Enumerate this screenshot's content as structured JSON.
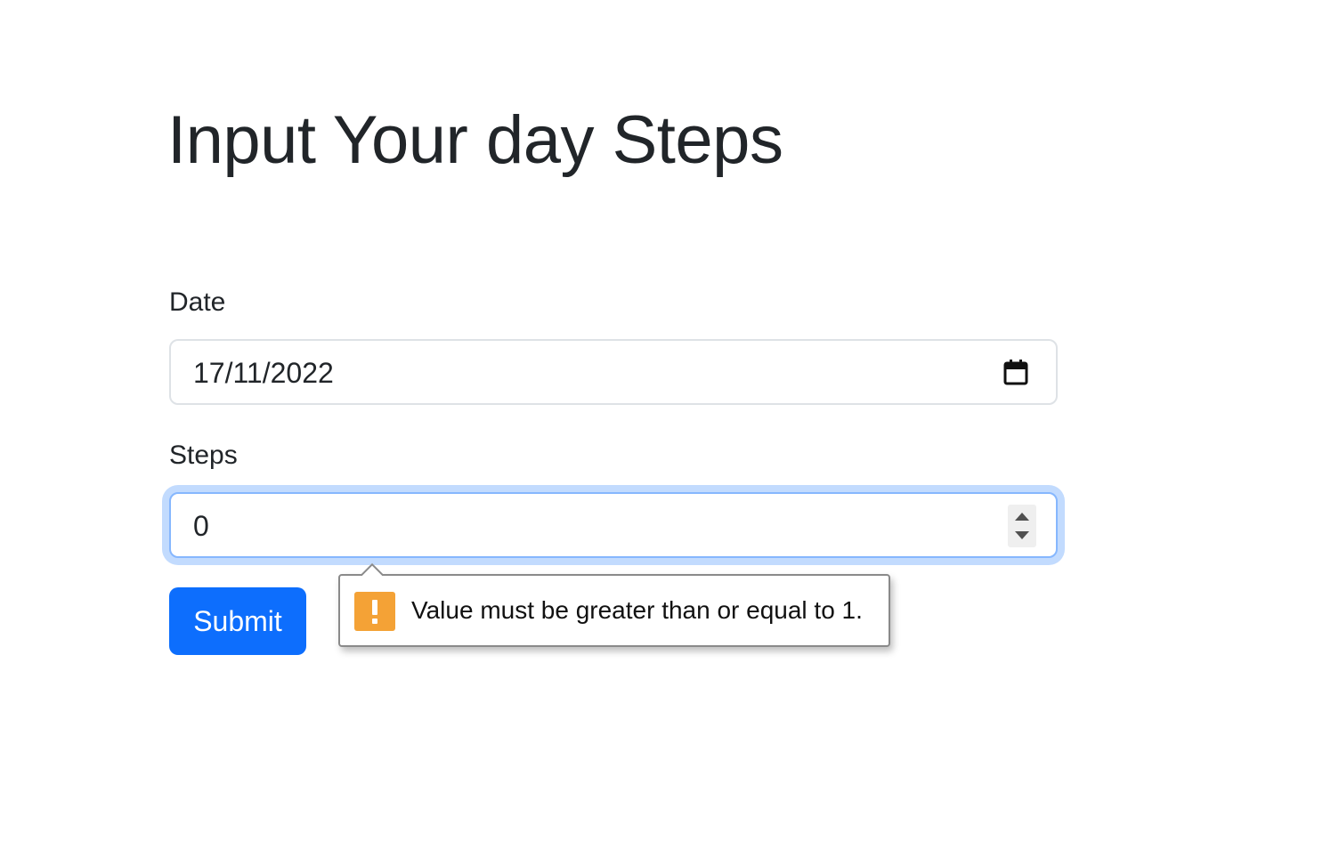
{
  "page": {
    "title": "Input Your day Steps"
  },
  "form": {
    "date": {
      "label": "Date",
      "value": "17/11/2022",
      "icon": "calendar-icon"
    },
    "steps": {
      "label": "Steps",
      "value": "0",
      "focused": true
    },
    "submit_label": "Submit"
  },
  "validation": {
    "message": "Value must be greater than or equal to 1.",
    "icon": "warning-icon"
  },
  "colors": {
    "primary": "#0d6efd",
    "focus_border": "#86b7fe",
    "warning": "#f4a236",
    "text": "#212529"
  }
}
